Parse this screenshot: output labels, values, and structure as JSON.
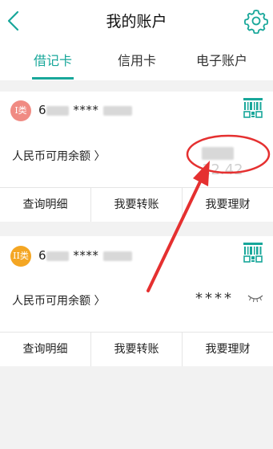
{
  "header": {
    "title": "我的账户"
  },
  "tabs": [
    {
      "label": "借记卡"
    },
    {
      "label": "信用卡"
    },
    {
      "label": "电子账户"
    }
  ],
  "cards": [
    {
      "badge": "I类",
      "card_prefix": "6",
      "card_mask": "****",
      "balance_label": "人民币可用余额 〉",
      "balance_visible_tail": "12.42",
      "actions": [
        "查询明细",
        "我要转账",
        "我要理财"
      ]
    },
    {
      "badge": "II类",
      "card_prefix": "6",
      "card_mask": "****",
      "balance_label": "人民币可用余额 〉",
      "balance_hidden": "****",
      "actions": [
        "查询明细",
        "我要转账",
        "我要理财"
      ]
    }
  ],
  "colors": {
    "accent": "#18a79a",
    "annotation": "#e53030"
  },
  "icons": {
    "back": "back-arrow-icon",
    "settings": "gear-icon",
    "qr": "qr-code-icon",
    "eye": "eye-closed-icon"
  }
}
